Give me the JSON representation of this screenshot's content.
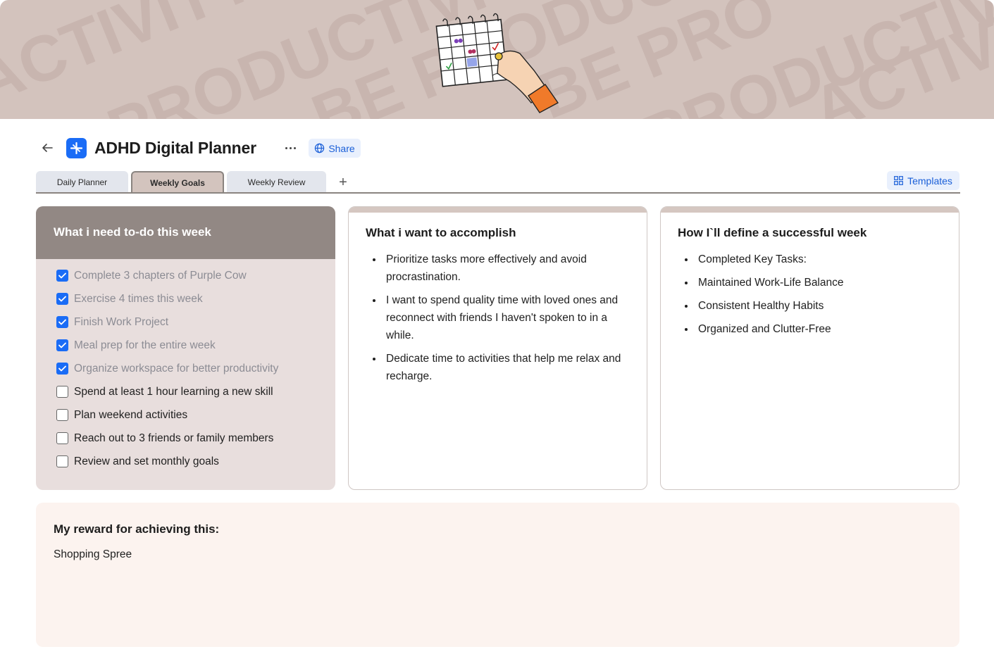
{
  "banner": {
    "words": [
      "ACTIVITY",
      "PRODUCTIVITY",
      "BE PRODUCTIVE",
      "BE PRO",
      "PRODUCTIVITY",
      "ACTIVITY"
    ],
    "background_color": "#d3c3bd"
  },
  "header": {
    "title": "ADHD Digital Planner",
    "share_label": "Share",
    "app_icon": "sparkle-icon",
    "accent_color": "#1a6cf6"
  },
  "tabs": [
    {
      "label": "Daily Planner",
      "active": false
    },
    {
      "label": "Weekly Goals",
      "active": true
    },
    {
      "label": "Weekly Review",
      "active": false
    }
  ],
  "templates_label": "Templates",
  "todo": {
    "title": "What i need to-do this week",
    "items": [
      {
        "text": "Complete 3 chapters of Purple Cow",
        "checked": true
      },
      {
        "text": "Exercise 4 times this week",
        "checked": true
      },
      {
        "text": "Finish Work Project",
        "checked": true
      },
      {
        "text": "Meal prep for the entire week",
        "checked": true
      },
      {
        "text": "Organize workspace for better productivity",
        "checked": true
      },
      {
        "text": "Spend at least 1 hour learning a new skill",
        "checked": false
      },
      {
        "text": "Plan weekend activities",
        "checked": false
      },
      {
        "text": "Reach out to 3 friends or family members",
        "checked": false
      },
      {
        "text": "Review and set monthly goals",
        "checked": false
      }
    ]
  },
  "accomplish": {
    "title": "What i want to accomplish",
    "items": [
      "Prioritize tasks more effectively and avoid procrastination.",
      "I want to spend quality time with loved ones and reconnect with friends I haven't spoken to in a while.",
      "Dedicate time to activities that help me relax and recharge."
    ]
  },
  "success": {
    "title": "How I`ll define a successful week",
    "items": [
      "Completed Key Tasks:",
      "Maintained Work-Life Balance",
      "Consistent Healthy Habits",
      "Organized and Clutter-Free"
    ]
  },
  "reward": {
    "title": "My reward for achieving this:",
    "text": "Shopping Spree"
  }
}
